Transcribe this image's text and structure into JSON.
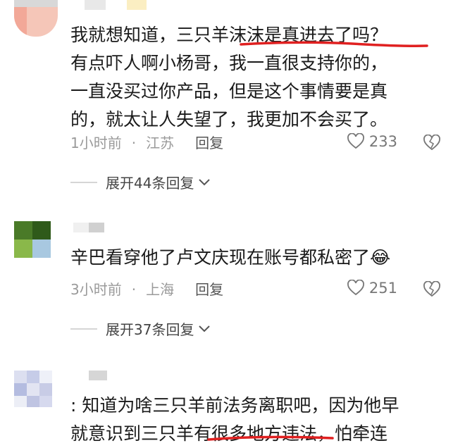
{
  "comments": [
    {
      "lines": [
        "我就想知道，三只羊沫沫是真进去了吗？",
        "有点吓人啊小杨哥，我一直很支持你的，",
        "一直没买过你产品，但是这个事情要是真",
        "的，就太让人失望了，我更加不会买了。"
      ],
      "time": "1小时前",
      "location": "江苏",
      "reply_label": "回复",
      "likes": "233",
      "expand_label": "展开44条回复"
    },
    {
      "lines": [
        "辛巴看穿他了卢文庆现在账号都私密了😂"
      ],
      "time": "3小时前",
      "location": "上海",
      "reply_label": "回复",
      "likes": "251",
      "expand_label": "展开37条回复"
    },
    {
      "lines": [
        ": 知道为啥三只羊前法务离职吧，因为他早",
        "就意识到三只羊有很多地方违法，怕牵连"
      ]
    }
  ],
  "colors": {
    "underline": "#e02020",
    "meta_text": "#9a9a9a"
  },
  "icons": [
    "heart-icon",
    "broken-heart-icon",
    "chevron-down-icon"
  ]
}
